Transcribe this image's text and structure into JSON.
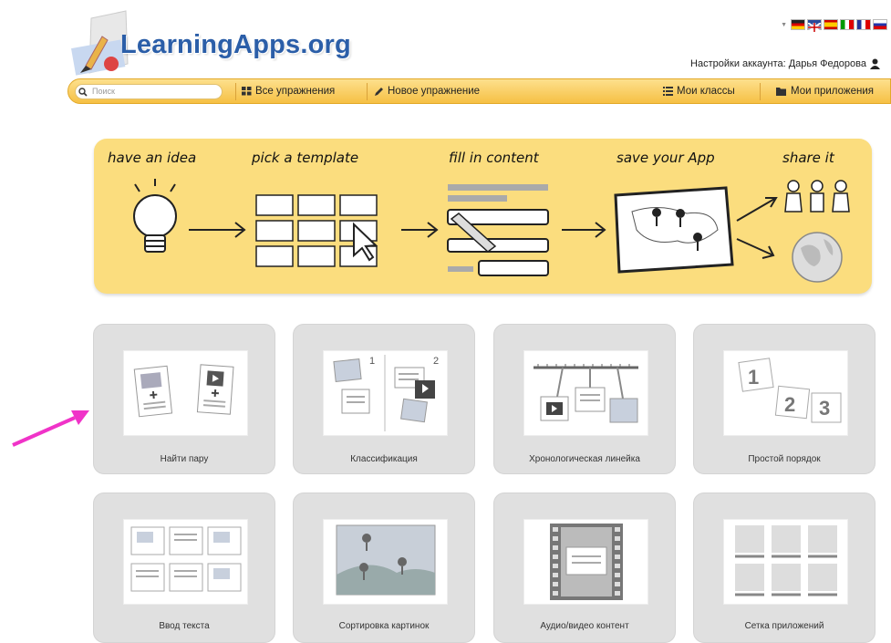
{
  "header": {
    "logo_text": "LearningApps.org",
    "account_label": "Настройки аккаунта: Дарья Федорова",
    "flags": [
      "de",
      "gb",
      "es",
      "it",
      "ru"
    ]
  },
  "nav": {
    "search_placeholder": "Поиск",
    "all_exercises": "Все упражнения",
    "new_exercise": "Новое упражнение",
    "my_classes": "Мои классы",
    "my_apps": "Мои приложения"
  },
  "banner": {
    "steps": [
      "have an idea",
      "pick a template",
      "fill in content",
      "save your App",
      "share it"
    ]
  },
  "templates": [
    {
      "label": "Найти пару",
      "icon": "pair-match-icon"
    },
    {
      "label": "Классификация",
      "icon": "classification-icon"
    },
    {
      "label": "Хронологическая линейка",
      "icon": "timeline-icon"
    },
    {
      "label": "Простой порядок",
      "icon": "simple-order-icon"
    },
    {
      "label": "Ввод текста",
      "icon": "text-input-icon"
    },
    {
      "label": "Сортировка картинок",
      "icon": "picture-sort-icon"
    },
    {
      "label": "Аудио/видео контент",
      "icon": "audio-video-icon"
    },
    {
      "label": "Сетка приложений",
      "icon": "app-grid-icon"
    }
  ],
  "colors": {
    "navbar": "#f6c044",
    "banner": "#fbdd7e",
    "logo": "#2b5ea8",
    "annotation_arrow": "#f033c8"
  }
}
